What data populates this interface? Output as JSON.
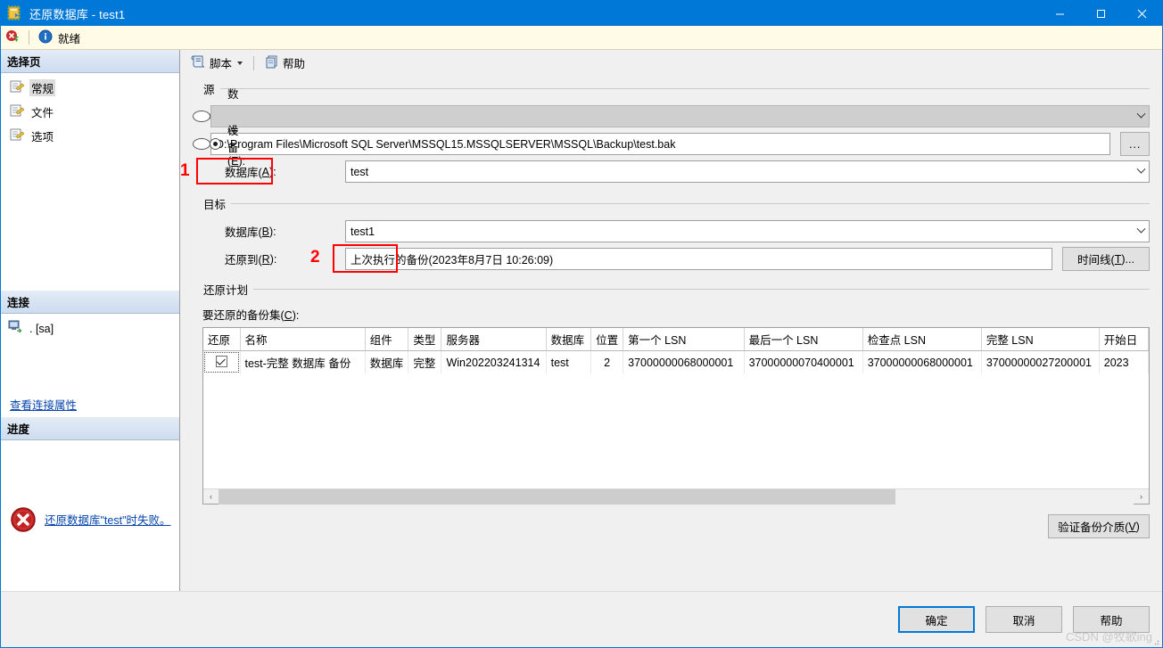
{
  "window": {
    "title": "还原数据库 - test1",
    "icon": "restore-database-icon",
    "minimize": "—",
    "maximize": "▢",
    "close": "✕"
  },
  "statusbar": {
    "error_icon": "error-icon",
    "info_icon": "info-icon",
    "text": "就绪"
  },
  "sidebar": {
    "select_page_header": "选择页",
    "items": [
      {
        "label": "常规",
        "selected": true
      },
      {
        "label": "文件",
        "selected": false
      },
      {
        "label": "选项",
        "selected": false
      }
    ],
    "connection_header": "连接",
    "connection_value": ". [sa]",
    "view_connection_link": "查看连接属性",
    "progress_header": "进度",
    "progress_message": "还原数据库\"test\"时失败。"
  },
  "toolbar": {
    "script_label": "脚本",
    "help_label": "帮助"
  },
  "source": {
    "group_title": "源",
    "database_radio_label": "数据库(D):",
    "database_radio_accel": "D",
    "database_radio_selected": false,
    "database_value": "",
    "device_radio_label": "设备(E):",
    "device_radio_accel": "E",
    "device_radio_selected": true,
    "device_value": "D:\\Program Files\\Microsoft SQL Server\\MSSQL15.MSSQLSERVER\\MSSQL\\Backup\\test.bak",
    "browse_button": "...",
    "db_label": "数据库(A):",
    "db_accel": "A",
    "db_value": "test"
  },
  "destination": {
    "group_title": "目标",
    "database_label": "数据库(B):",
    "database_accel": "B",
    "database_value": "test1",
    "restore_to_label": "还原到(R):",
    "restore_to_accel": "R",
    "restore_to_value": "上次执行的备份(2023年8月7日 10:26:09)",
    "timeline_button": "时间线(T)...",
    "timeline_accel": "T"
  },
  "restore_plan": {
    "group_title": "还原计划",
    "backup_sets_label": "要还原的备份集(C):",
    "backup_sets_accel": "C",
    "columns": [
      "还原",
      "名称",
      "组件",
      "类型",
      "服务器",
      "数据库",
      "位置",
      "第一个 LSN",
      "最后一个 LSN",
      "检查点 LSN",
      "完整 LSN",
      "开始日"
    ],
    "rows": [
      {
        "restore_checked": true,
        "name": "test-完整 数据库 备份",
        "component": "数据库",
        "type": "完整",
        "server": "Win202203241314",
        "database": "test",
        "position": "2",
        "first_lsn": "37000000068000001",
        "last_lsn": "37000000070400001",
        "checkpoint_lsn": "37000000068000001",
        "full_lsn": "37000000027200001",
        "start_date": "2023"
      }
    ],
    "verify_button": "验证备份介质(V)",
    "verify_accel": "V"
  },
  "footer": {
    "ok_button": "确定",
    "cancel_button": "取消",
    "help_button": "帮助",
    "watermark": "CSDN @牧歌ing"
  },
  "annotations": [
    {
      "number": "1",
      "target": "device-radio"
    },
    {
      "number": "2",
      "target": "destination-database-input"
    }
  ],
  "colors": {
    "accent": "#0078d7",
    "annotation": "#ff0000",
    "status_bg": "#fffbe6",
    "link": "#0645ad"
  }
}
